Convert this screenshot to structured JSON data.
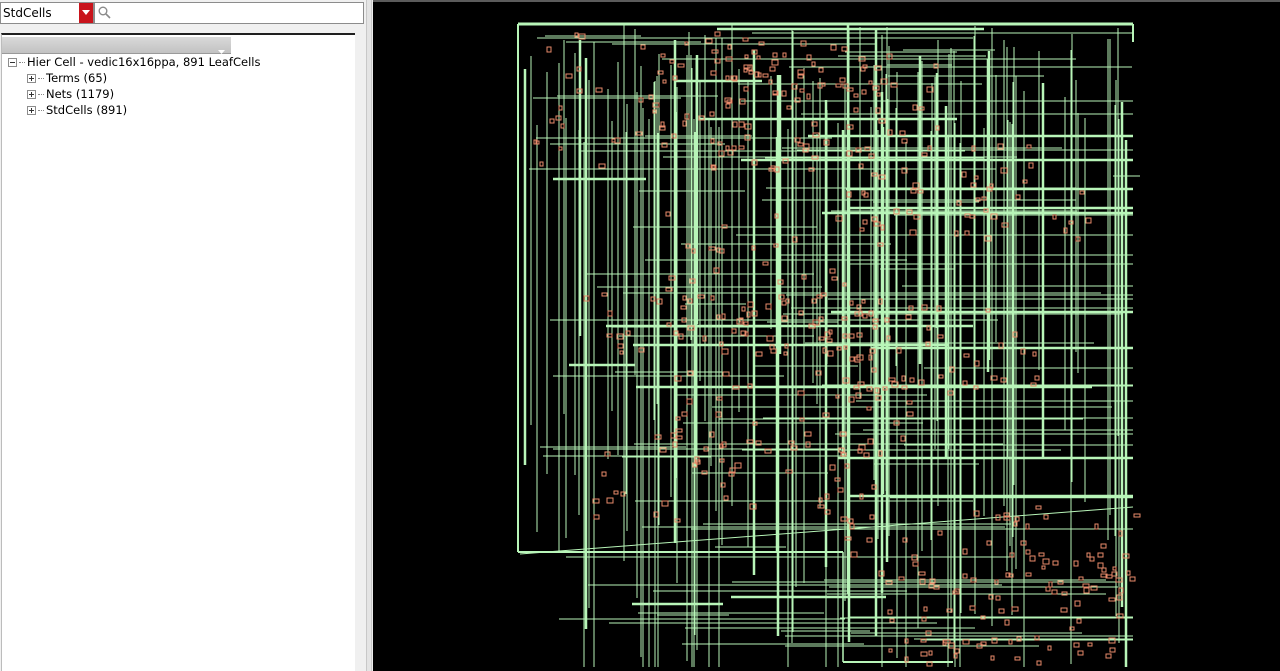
{
  "filter": {
    "selected": "StdCells"
  },
  "search": {
    "placeholder": ""
  },
  "tree": {
    "root": {
      "label": "Hier Cell - vedic16x16ppa, 891 LeafCells"
    },
    "children": [
      {
        "label": "Terms (65)"
      },
      {
        "label": "Nets (1179)"
      },
      {
        "label": "StdCells (891)"
      }
    ]
  },
  "layout": {
    "background_color": "#000000",
    "wire_color": "#b8f5b8",
    "cell_color": "#e88a6a"
  },
  "icons": [
    "chevron-down-icon",
    "search-icon",
    "collapse-icon",
    "expand-icon"
  ]
}
